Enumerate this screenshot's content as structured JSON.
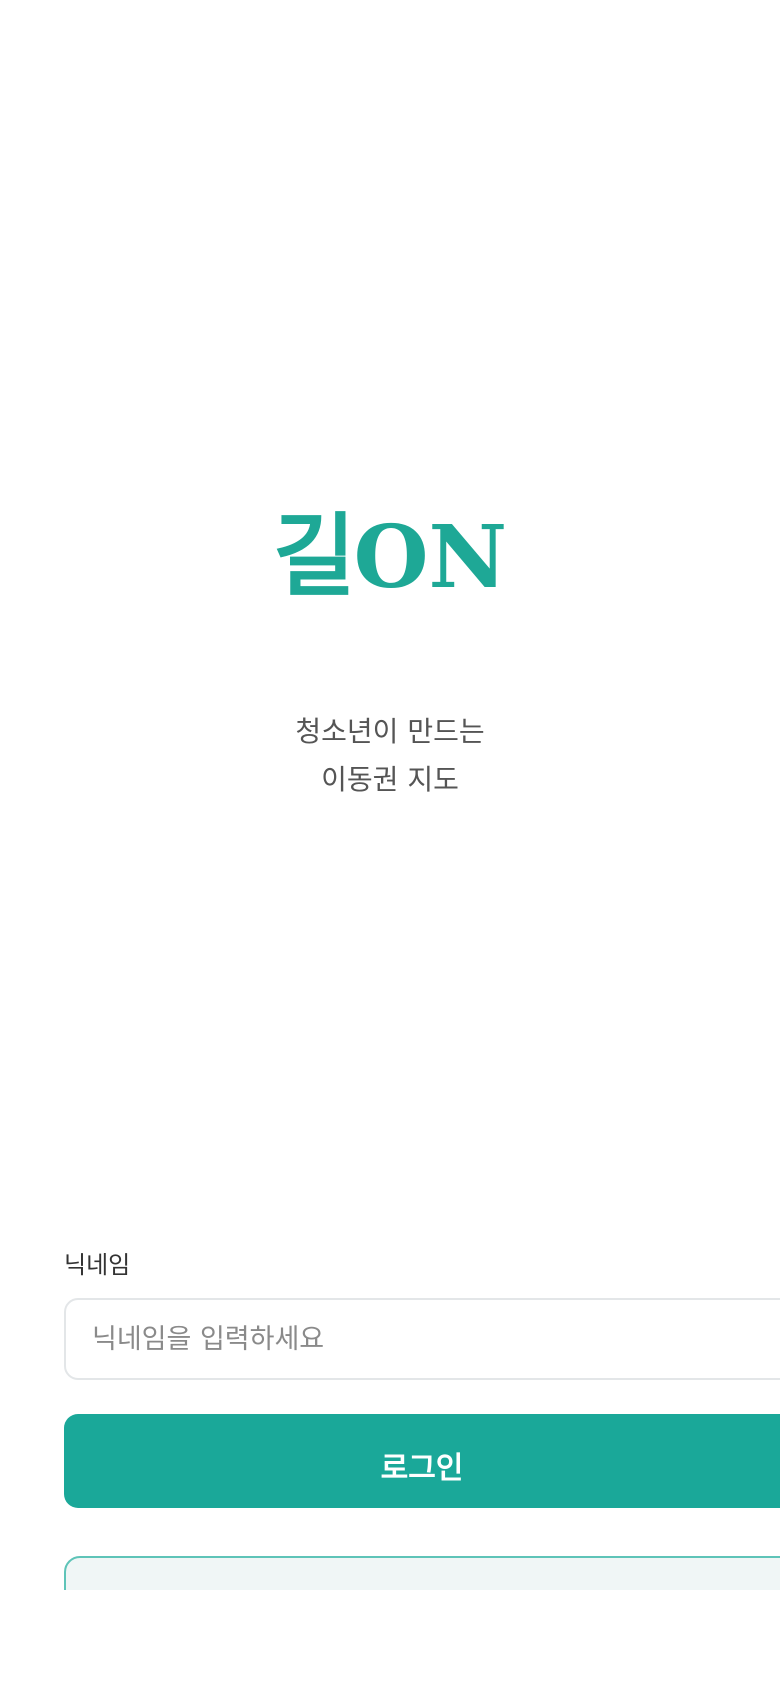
{
  "app": {
    "logo_ko": "길",
    "logo_en": "ON",
    "tagline_line1": "청소년이 만드는",
    "tagline_line2": "이동권 지도"
  },
  "login_form": {
    "nickname_label": "닉네임",
    "nickname_placeholder": "닉네임을 입력하세요",
    "nickname_value": "",
    "login_button_label": "로그인"
  },
  "colors": {
    "brand": "#1ea896",
    "button": "#1aa899",
    "card_border": "#5ec4b8",
    "card_background": "#f0f6f6"
  }
}
